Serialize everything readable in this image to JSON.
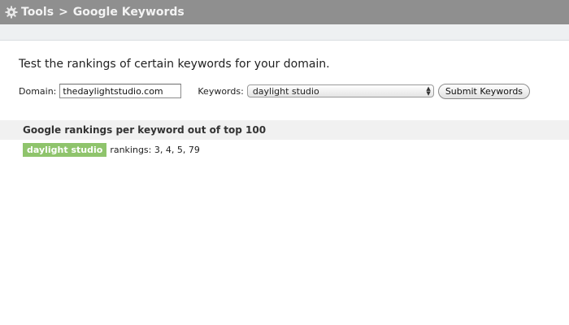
{
  "breadcrumb": {
    "root": "Tools",
    "separator": ">",
    "current": "Google Keywords"
  },
  "intro": "Test the rankings of certain keywords for your domain.",
  "form": {
    "domain_label": "Domain:",
    "domain_value": "thedaylightstudio.com",
    "keywords_label": "Keywords:",
    "keywords_selected": "daylight studio",
    "submit_label": "Submit Keywords"
  },
  "results": {
    "heading": "Google rankings per keyword out of top 100",
    "items": [
      {
        "keyword": "daylight studio",
        "rankings": "rankings: 3, 4, 5, 79"
      }
    ]
  }
}
